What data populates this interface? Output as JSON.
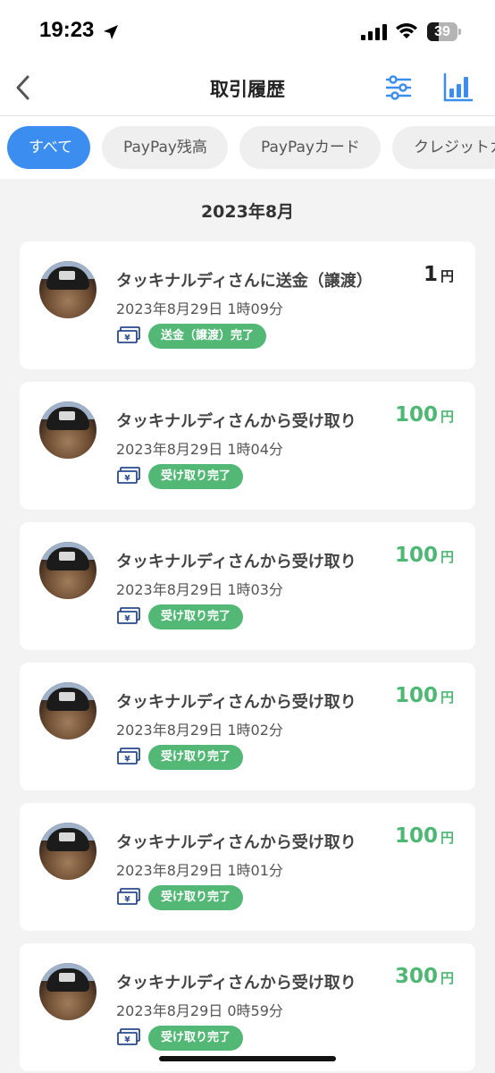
{
  "status_bar": {
    "time": "19:23",
    "battery": "39",
    "battery_level": 0.39
  },
  "header": {
    "title": "取引履歴"
  },
  "filters": [
    {
      "label": "すべて",
      "active": true
    },
    {
      "label": "PayPay残高",
      "active": false
    },
    {
      "label": "PayPayカード",
      "active": false
    },
    {
      "label": "クレジットカ",
      "active": false
    }
  ],
  "month": "2023年8月",
  "transactions": [
    {
      "title": "タッキナルディさんに送金（譲渡）",
      "date": "2023年8月29日 1時09分",
      "status": "送金（譲渡）完了",
      "amount": "1",
      "unit": "円",
      "kind": "neutral"
    },
    {
      "title": "タッキナルディさんから受け取り",
      "date": "2023年8月29日 1時04分",
      "status": "受け取り完了",
      "amount": "100",
      "unit": "円",
      "kind": "positive"
    },
    {
      "title": "タッキナルディさんから受け取り",
      "date": "2023年8月29日 1時03分",
      "status": "受け取り完了",
      "amount": "100",
      "unit": "円",
      "kind": "positive"
    },
    {
      "title": "タッキナルディさんから受け取り",
      "date": "2023年8月29日 1時02分",
      "status": "受け取り完了",
      "amount": "100",
      "unit": "円",
      "kind": "positive"
    },
    {
      "title": "タッキナルディさんから受け取り",
      "date": "2023年8月29日 1時01分",
      "status": "受け取り完了",
      "amount": "100",
      "unit": "円",
      "kind": "positive"
    },
    {
      "title": "タッキナルディさんから受け取り",
      "date": "2023年8月29日 0時59分",
      "status": "受け取り完了",
      "amount": "300",
      "unit": "円",
      "kind": "positive"
    }
  ],
  "icons": {
    "back": "chevron-left-icon",
    "filter": "sliders-icon",
    "chart": "bar-chart-icon",
    "money": "banknote-yen-icon"
  },
  "colors": {
    "accent": "#3c8df0",
    "positive": "#4fb774",
    "badge": "#53b876"
  }
}
